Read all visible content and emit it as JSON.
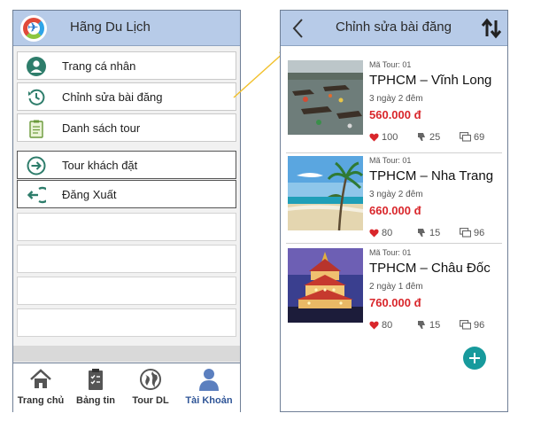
{
  "left_screen": {
    "app_title": "Hãng Du Lịch",
    "menu": [
      {
        "label": "Trang cá nhân",
        "icon": "user-icon"
      },
      {
        "label": "Chỉnh sửa bài đăng",
        "icon": "history-icon"
      },
      {
        "label": "Danh sách tour",
        "icon": "clipboard-icon"
      },
      {
        "label": "Tour khách đặt",
        "icon": "arrow-circle-icon"
      },
      {
        "label": "Đăng Xuất",
        "icon": "logout-icon"
      }
    ],
    "bottom_nav": [
      {
        "label": "Trang chủ",
        "icon": "home-icon"
      },
      {
        "label": "Bảng tin",
        "icon": "checklist-icon"
      },
      {
        "label": "Tour DL",
        "icon": "globe-icon"
      },
      {
        "label": "Tài Khoản",
        "icon": "account-icon",
        "active": true
      }
    ]
  },
  "right_screen": {
    "title": "Chỉnh sửa bài đăng",
    "tours": [
      {
        "code": "Mã Tour: 01",
        "name": "TPHCM – Vĩnh Long",
        "duration": "3 ngày 2 đêm",
        "price": "560.000 đ",
        "likes": "100",
        "dislikes": "25",
        "comments": "69"
      },
      {
        "code": "Mã Tour: 01",
        "name": "TPHCM – Nha Trang",
        "duration": "3 ngày 2 đêm",
        "price": "660.000 đ",
        "likes": "80",
        "dislikes": "15",
        "comments": "96"
      },
      {
        "code": "Mã Tour: 01",
        "name": "TPHCM – Châu Đốc",
        "duration": "2 ngày 1 đêm",
        "price": "760.000 đ",
        "likes": "80",
        "dislikes": "15",
        "comments": "96"
      }
    ]
  },
  "colors": {
    "header": "#b7cbe8",
    "price": "#d9262b",
    "heart": "#d9262b",
    "fab": "#179a9c",
    "nav_active": "#2f5597",
    "menu_icon": "#2e7d6b",
    "arrow": "#f2c12e"
  }
}
